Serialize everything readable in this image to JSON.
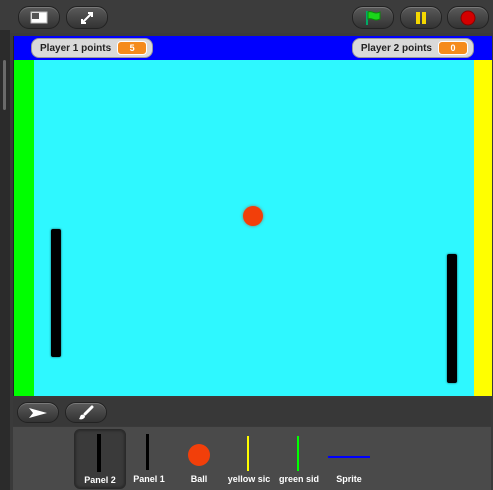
{
  "toolbar": {
    "icons": [
      "presentation-mode-icon",
      "fullscreen-icon",
      "green-flag-icon",
      "pause-icon",
      "stop-icon"
    ],
    "colors": {
      "flag": "#00c000",
      "pause": "#f5d800",
      "stop": "#d40000"
    }
  },
  "stage": {
    "background": "#2ef8ff",
    "top_bar_color": "#0000ff",
    "left_side_color": "#00ff00",
    "right_side_color": "#ffff00",
    "watchers": [
      {
        "label": "Player 1 points",
        "value": "5"
      },
      {
        "label": "Player 2 points",
        "value": "0"
      }
    ],
    "ball_color": "#f23f0a"
  },
  "tools": {
    "icons": [
      "arrow-tool-icon",
      "paintbrush-icon"
    ]
  },
  "sprites": [
    {
      "name": "Panel 2",
      "selected": true
    },
    {
      "name": "Panel 1",
      "selected": false
    },
    {
      "name": "Ball",
      "selected": false
    },
    {
      "name": "yellow sic",
      "selected": false
    },
    {
      "name": "green sid",
      "selected": false
    },
    {
      "name": "Sprite",
      "selected": false
    }
  ]
}
